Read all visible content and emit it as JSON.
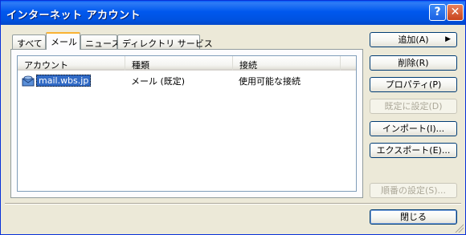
{
  "window": {
    "title": "インターネット アカウント",
    "help_glyph": "?",
    "close_glyph": "✕"
  },
  "tabs": [
    {
      "label": "すべて",
      "active": false
    },
    {
      "label": "メール",
      "active": true
    },
    {
      "label": "ニュース",
      "active": false
    },
    {
      "label": "ディレクトリ サービス",
      "active": false
    }
  ],
  "list": {
    "columns": [
      "アカウント",
      "種類",
      "接続"
    ],
    "rows": [
      {
        "account": "mail.wbs.jp",
        "type": "メール (既定)",
        "connection": "使用可能な接続",
        "icon": "mail-account-icon",
        "selected": true
      }
    ]
  },
  "buttons": {
    "add": "追加(A)",
    "delete": "削除(R)",
    "properties": "プロパティ(P)",
    "set_default": "既定に設定(D)",
    "import": "インポート(I)...",
    "export": "エクスポート(E)...",
    "order": "順番の設定(S)...",
    "close": "閉じる"
  },
  "colors": {
    "titlebar": "#0058ee",
    "selection": "#316ac5",
    "active_tab_accent": "#f9b233"
  }
}
